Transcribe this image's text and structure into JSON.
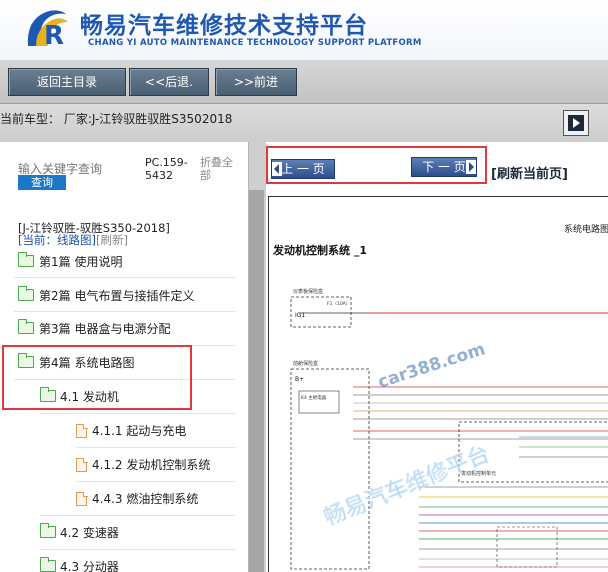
{
  "header": {
    "title_cn": "畅易汽车维修技术支持平台",
    "title_en": "CHANG YI AUTO MAINTENANCE TECHNOLOGY SUPPORT PLATFORM",
    "brand_color": "#1f58b3"
  },
  "nav": {
    "home": "返回主目录",
    "back": "<<后退.",
    "forward": ">>前进"
  },
  "model": {
    "text": "当前车型： 厂家:J-江铃驭胜驭胜S3502018"
  },
  "left": {
    "search_placeholder": "输入关键字查询",
    "search_button": "查询",
    "pc_code": "PC.159-5432",
    "collapse_all": "折叠全部",
    "car_name": "[J-江铃驭胜-驭胜S350-2018]",
    "current_label": "[当前：线路图]",
    "refresh_link": "[刷新]",
    "tree": [
      {
        "label": "第1篇 使用说明",
        "type": "folder"
      },
      {
        "label": "第2篇 电气布置与接插件定义",
        "type": "folder"
      },
      {
        "label": "第3篇 电器盒与电源分配",
        "type": "folder"
      },
      {
        "label": "第4篇 系统电路图",
        "type": "folder-open"
      },
      {
        "label": "4.1 发动机",
        "type": "folder-open"
      },
      {
        "label": "4.1.1 起动与充电",
        "type": "doc"
      },
      {
        "label": "4.1.2 发动机控制系统",
        "type": "doc"
      },
      {
        "label": "4.4.3 燃油控制系统",
        "type": "doc"
      },
      {
        "label": "4.2 变速器",
        "type": "folder"
      },
      {
        "label": "4.3 分动器",
        "type": "folder"
      }
    ]
  },
  "right": {
    "prev_page": "上 一 页",
    "next_page": "下 一 页",
    "refresh_page": "[刷新当前页]",
    "diagram_caption": "系统电路图",
    "diagram_title": "发动机控制系统 _1",
    "diagram_labels": {
      "panel_fuse": "仪表板保险盒",
      "ig1": "IG1",
      "fuse_f1": "F1（10A）",
      "engine_fuse": "前舱保险盒",
      "bplus": "B+",
      "k4": "K4 主继电器",
      "ecu": "发动机控制单元"
    }
  },
  "watermark": {
    "site": "car388.com",
    "name": "畅易汽车维修平台"
  },
  "colors": {
    "highlight_red": "#e0383c",
    "nav_button": "#4b5f72",
    "pager_button": "#2c4e8e",
    "folder_green": "#49a84a",
    "doc_orange": "#e29b55"
  }
}
